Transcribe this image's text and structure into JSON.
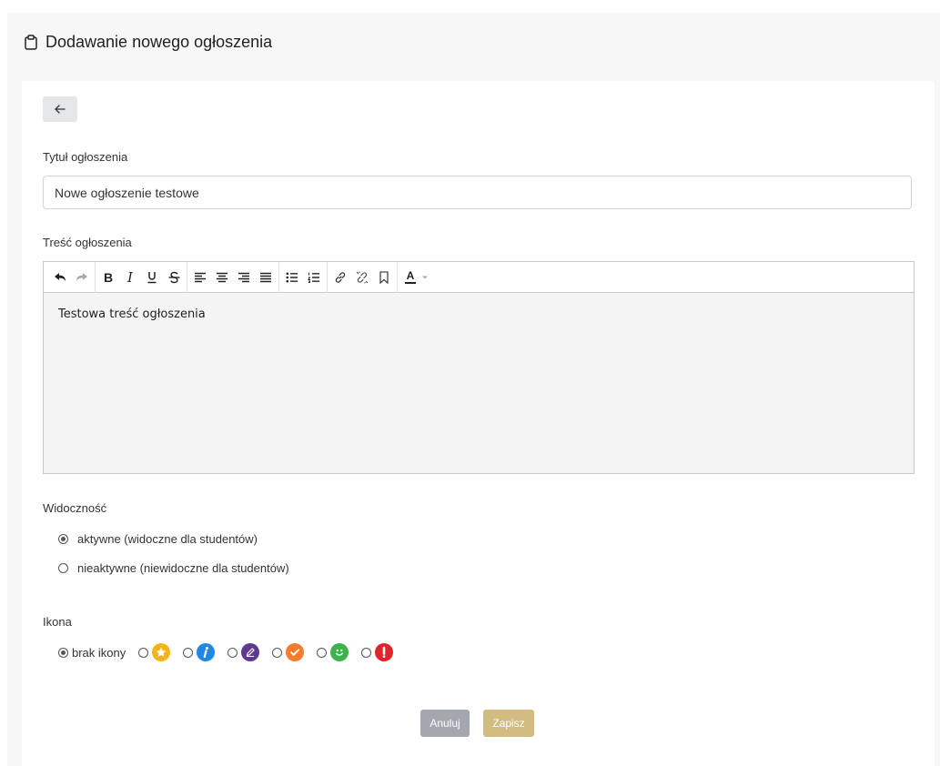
{
  "header": {
    "title": "Dodawanie nowego ogłoszenia",
    "icon": "clipboard-icon"
  },
  "form": {
    "back_icon": "arrow-left-icon",
    "title_label": "Tytuł ogłoszenia",
    "title_value": "Nowe ogłoszenie testowe",
    "content_label": "Treść ogłoszenia",
    "content_value": "Testowa treść ogłoszenia",
    "visibility_label": "Widoczność",
    "visibility_options": [
      {
        "label": "aktywne (widoczne dla studentów)",
        "selected": true
      },
      {
        "label": "nieaktywne (niewidoczne dla studentów)",
        "selected": false
      }
    ],
    "icon_label": "Ikona",
    "icon_options": [
      {
        "label": "brak ikony",
        "selected": true
      },
      {
        "icon": "star-icon",
        "color": "#f5b31b",
        "selected": false
      },
      {
        "icon": "info-icon",
        "color": "#1e88e5",
        "selected": false
      },
      {
        "icon": "pencil-icon",
        "color": "#5e3a8e",
        "selected": false
      },
      {
        "icon": "checkmark-icon",
        "color": "#f57c2a",
        "selected": false
      },
      {
        "icon": "smiley-icon",
        "color": "#3cb44b",
        "selected": false
      },
      {
        "icon": "exclamation-icon",
        "color": "#e0242c",
        "selected": false
      }
    ],
    "cancel_label": "Anuluj",
    "save_label": "Zapisz"
  },
  "toolbar": {
    "groups": [
      [
        "undo-icon",
        "redo-icon"
      ],
      [
        "bold-icon",
        "italic-icon",
        "underline-icon",
        "strikethrough-icon"
      ],
      [
        "align-left-icon",
        "align-center-icon",
        "align-right-icon",
        "align-justify-icon"
      ],
      [
        "bullet-list-icon",
        "numbered-list-icon"
      ],
      [
        "link-icon",
        "unlink-icon",
        "bookmark-icon"
      ],
      [
        "text-color-icon"
      ]
    ],
    "bold": "B",
    "italic": "I",
    "text_color_letter": "A"
  },
  "colors": {
    "cancel_button": "#a2a8ae",
    "save_button": "#d2bc82",
    "background": "#f7f7f7"
  }
}
